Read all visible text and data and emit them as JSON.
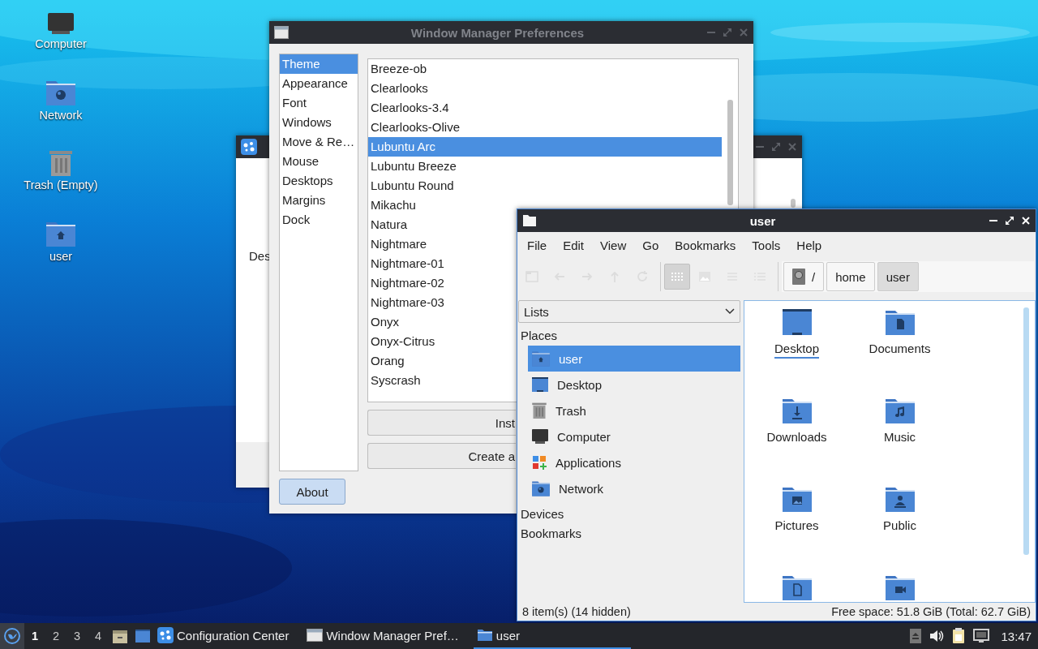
{
  "desktop_icons": [
    {
      "label": "Computer",
      "kind": "computer"
    },
    {
      "label": "Network",
      "kind": "network"
    },
    {
      "label": "Trash (Empty)",
      "kind": "trash"
    },
    {
      "label": "user",
      "kind": "home"
    }
  ],
  "background_window": {
    "active": false,
    "texts": [
      "Des"
    ]
  },
  "wm_window": {
    "title": "Window Manager Preferences",
    "active": false,
    "sections": [
      {
        "label": "Theme",
        "selected": true
      },
      {
        "label": "Appearance",
        "selected": false
      },
      {
        "label": "Font",
        "selected": false
      },
      {
        "label": "Windows",
        "selected": false
      },
      {
        "label": "Move & Re…",
        "selected": false
      },
      {
        "label": "Mouse",
        "selected": false
      },
      {
        "label": "Desktops",
        "selected": false
      },
      {
        "label": "Margins",
        "selected": false
      },
      {
        "label": "Dock",
        "selected": false
      }
    ],
    "themes": [
      {
        "label": "Breeze-ob",
        "selected": false
      },
      {
        "label": "Clearlooks",
        "selected": false
      },
      {
        "label": "Clearlooks-3.4",
        "selected": false
      },
      {
        "label": "Clearlooks-Olive",
        "selected": false
      },
      {
        "label": "Lubuntu Arc",
        "selected": true
      },
      {
        "label": "Lubuntu Breeze",
        "selected": false
      },
      {
        "label": "Lubuntu Round",
        "selected": false
      },
      {
        "label": "Mikachu",
        "selected": false
      },
      {
        "label": "Natura",
        "selected": false
      },
      {
        "label": "Nightmare",
        "selected": false
      },
      {
        "label": "Nightmare-01",
        "selected": false
      },
      {
        "label": "Nightmare-02",
        "selected": false
      },
      {
        "label": "Nightmare-03",
        "selected": false
      },
      {
        "label": "Onyx",
        "selected": false
      },
      {
        "label": "Onyx-Citrus",
        "selected": false
      },
      {
        "label": "Orang",
        "selected": false
      },
      {
        "label": "Syscrash",
        "selected": false
      }
    ],
    "buttons": [
      "Inst",
      "Create a"
    ],
    "about": "About"
  },
  "file_manager": {
    "title": "user",
    "active": true,
    "menu": [
      "File",
      "Edit",
      "View",
      "Go",
      "Bookmarks",
      "Tools",
      "Help"
    ],
    "nav_buttons": [
      {
        "kind": "tab",
        "disabled": true
      },
      {
        "kind": "back",
        "disabled": true
      },
      {
        "kind": "forward",
        "disabled": true
      },
      {
        "kind": "up",
        "disabled": true
      },
      {
        "kind": "reload",
        "disabled": true
      }
    ],
    "view_modes": [
      {
        "kind": "icons",
        "selected": true
      },
      {
        "kind": "thumbnails",
        "selected": false
      },
      {
        "kind": "compact",
        "selected": false
      },
      {
        "kind": "detailed",
        "selected": false
      }
    ],
    "path": [
      {
        "label": "/",
        "kind": "root",
        "selected": false
      },
      {
        "label": "home",
        "kind": "dir",
        "selected": false
      },
      {
        "label": "user",
        "kind": "dir",
        "selected": true
      }
    ],
    "side_dropdown": "Lists",
    "places_heading": "Places",
    "places": [
      {
        "label": "user",
        "kind": "home",
        "selected": true
      },
      {
        "label": "Desktop",
        "kind": "desktop",
        "selected": false
      },
      {
        "label": "Trash",
        "kind": "trash",
        "selected": false
      },
      {
        "label": "Computer",
        "kind": "computer",
        "selected": false
      },
      {
        "label": "Applications",
        "kind": "apps",
        "selected": false
      },
      {
        "label": "Network",
        "kind": "network",
        "selected": false
      }
    ],
    "other_headings": [
      "Devices",
      "Bookmarks"
    ],
    "files": [
      {
        "label": "Desktop",
        "kind": "desktop",
        "selected": true
      },
      {
        "label": "Documents",
        "kind": "documents",
        "selected": false
      },
      {
        "label": "Downloads",
        "kind": "downloads",
        "selected": false
      },
      {
        "label": "Music",
        "kind": "music",
        "selected": false
      },
      {
        "label": "Pictures",
        "kind": "pictures",
        "selected": false
      },
      {
        "label": "Public",
        "kind": "public",
        "selected": false
      },
      {
        "kind": "templates",
        "selected": false
      },
      {
        "kind": "videos",
        "selected": false
      }
    ],
    "status_left": "8 item(s) (14 hidden)",
    "status_right": "Free space: 51.8 GiB (Total: 62.7 GiB)"
  },
  "taskbar": {
    "workspaces": [
      {
        "label": "1",
        "selected": true
      },
      {
        "label": "2",
        "selected": false
      },
      {
        "label": "3",
        "selected": false
      },
      {
        "label": "4",
        "selected": false
      }
    ],
    "launchers": [
      {
        "kind": "files"
      },
      {
        "kind": "desktop"
      }
    ],
    "tasks": [
      {
        "label": "Configuration Center",
        "kind": "config",
        "selected": false
      },
      {
        "label": "Window Manager Pref…",
        "kind": "window",
        "selected": false
      },
      {
        "label": "user",
        "kind": "folder",
        "selected": true
      }
    ],
    "tray": [
      {
        "kind": "eject"
      },
      {
        "kind": "volume"
      },
      {
        "kind": "clipboard"
      },
      {
        "kind": "network"
      }
    ],
    "clock": "13:47"
  }
}
